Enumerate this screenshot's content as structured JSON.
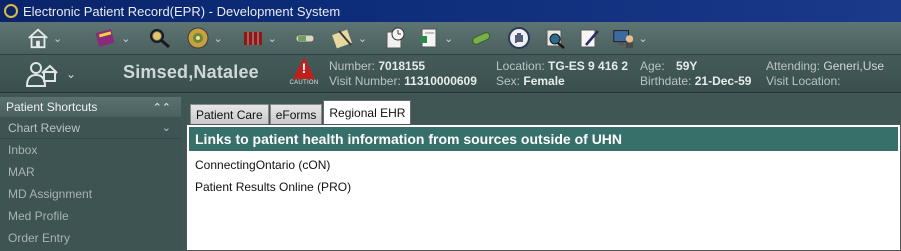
{
  "window": {
    "title": "Electronic Patient Record(EPR) - Development System"
  },
  "toolbar": {
    "icons": [
      "home-icon",
      "chart-book-icon",
      "patient-search-icon",
      "medication-wheel-icon",
      "order-list-icon",
      "lab-tube-icon",
      "document-pen-icon",
      "clock-note-icon",
      "notes-icon",
      "pill-icon",
      "hand-stop-icon",
      "binoculars-icon",
      "edit-note-icon",
      "person-computer-icon"
    ]
  },
  "banner": {
    "patient_name": "Simsed,Natalee",
    "caution_label": "CAUTION",
    "number_label": "Number:",
    "number": "7018155",
    "visit_number_label": "Visit Number:",
    "visit_number": "11310000609",
    "location_label": "Location:",
    "location": "TG-ES 9 416 2",
    "sex_label": "Sex:",
    "sex": "Female",
    "age_label": "Age:",
    "age": "59Y",
    "birthdate_label": "Birthdate:",
    "birthdate": "21-Dec-59",
    "attending_label": "Attending:",
    "attending": "Generi,Use",
    "visit_location_label": "Visit Location:"
  },
  "sidebar": {
    "header": "Patient Shortcuts",
    "section": "Chart Review",
    "items": [
      "Inbox",
      "MAR",
      "MD Assignment",
      "Med Profile",
      "Order Entry"
    ]
  },
  "main": {
    "tabs": [
      "Patient Care",
      "eForms",
      "Regional EHR"
    ],
    "active_tab": "Regional EHR",
    "panel_title": "Links to patient health information from sources outside of UHN",
    "links": [
      "ConnectingOntario (cON)",
      "Patient Results Online (PRO)"
    ]
  },
  "colors": {
    "titlebar": "#0a246a",
    "chrome": "#3f5654",
    "panel_header": "#37706a",
    "caution": "#c0201c"
  }
}
